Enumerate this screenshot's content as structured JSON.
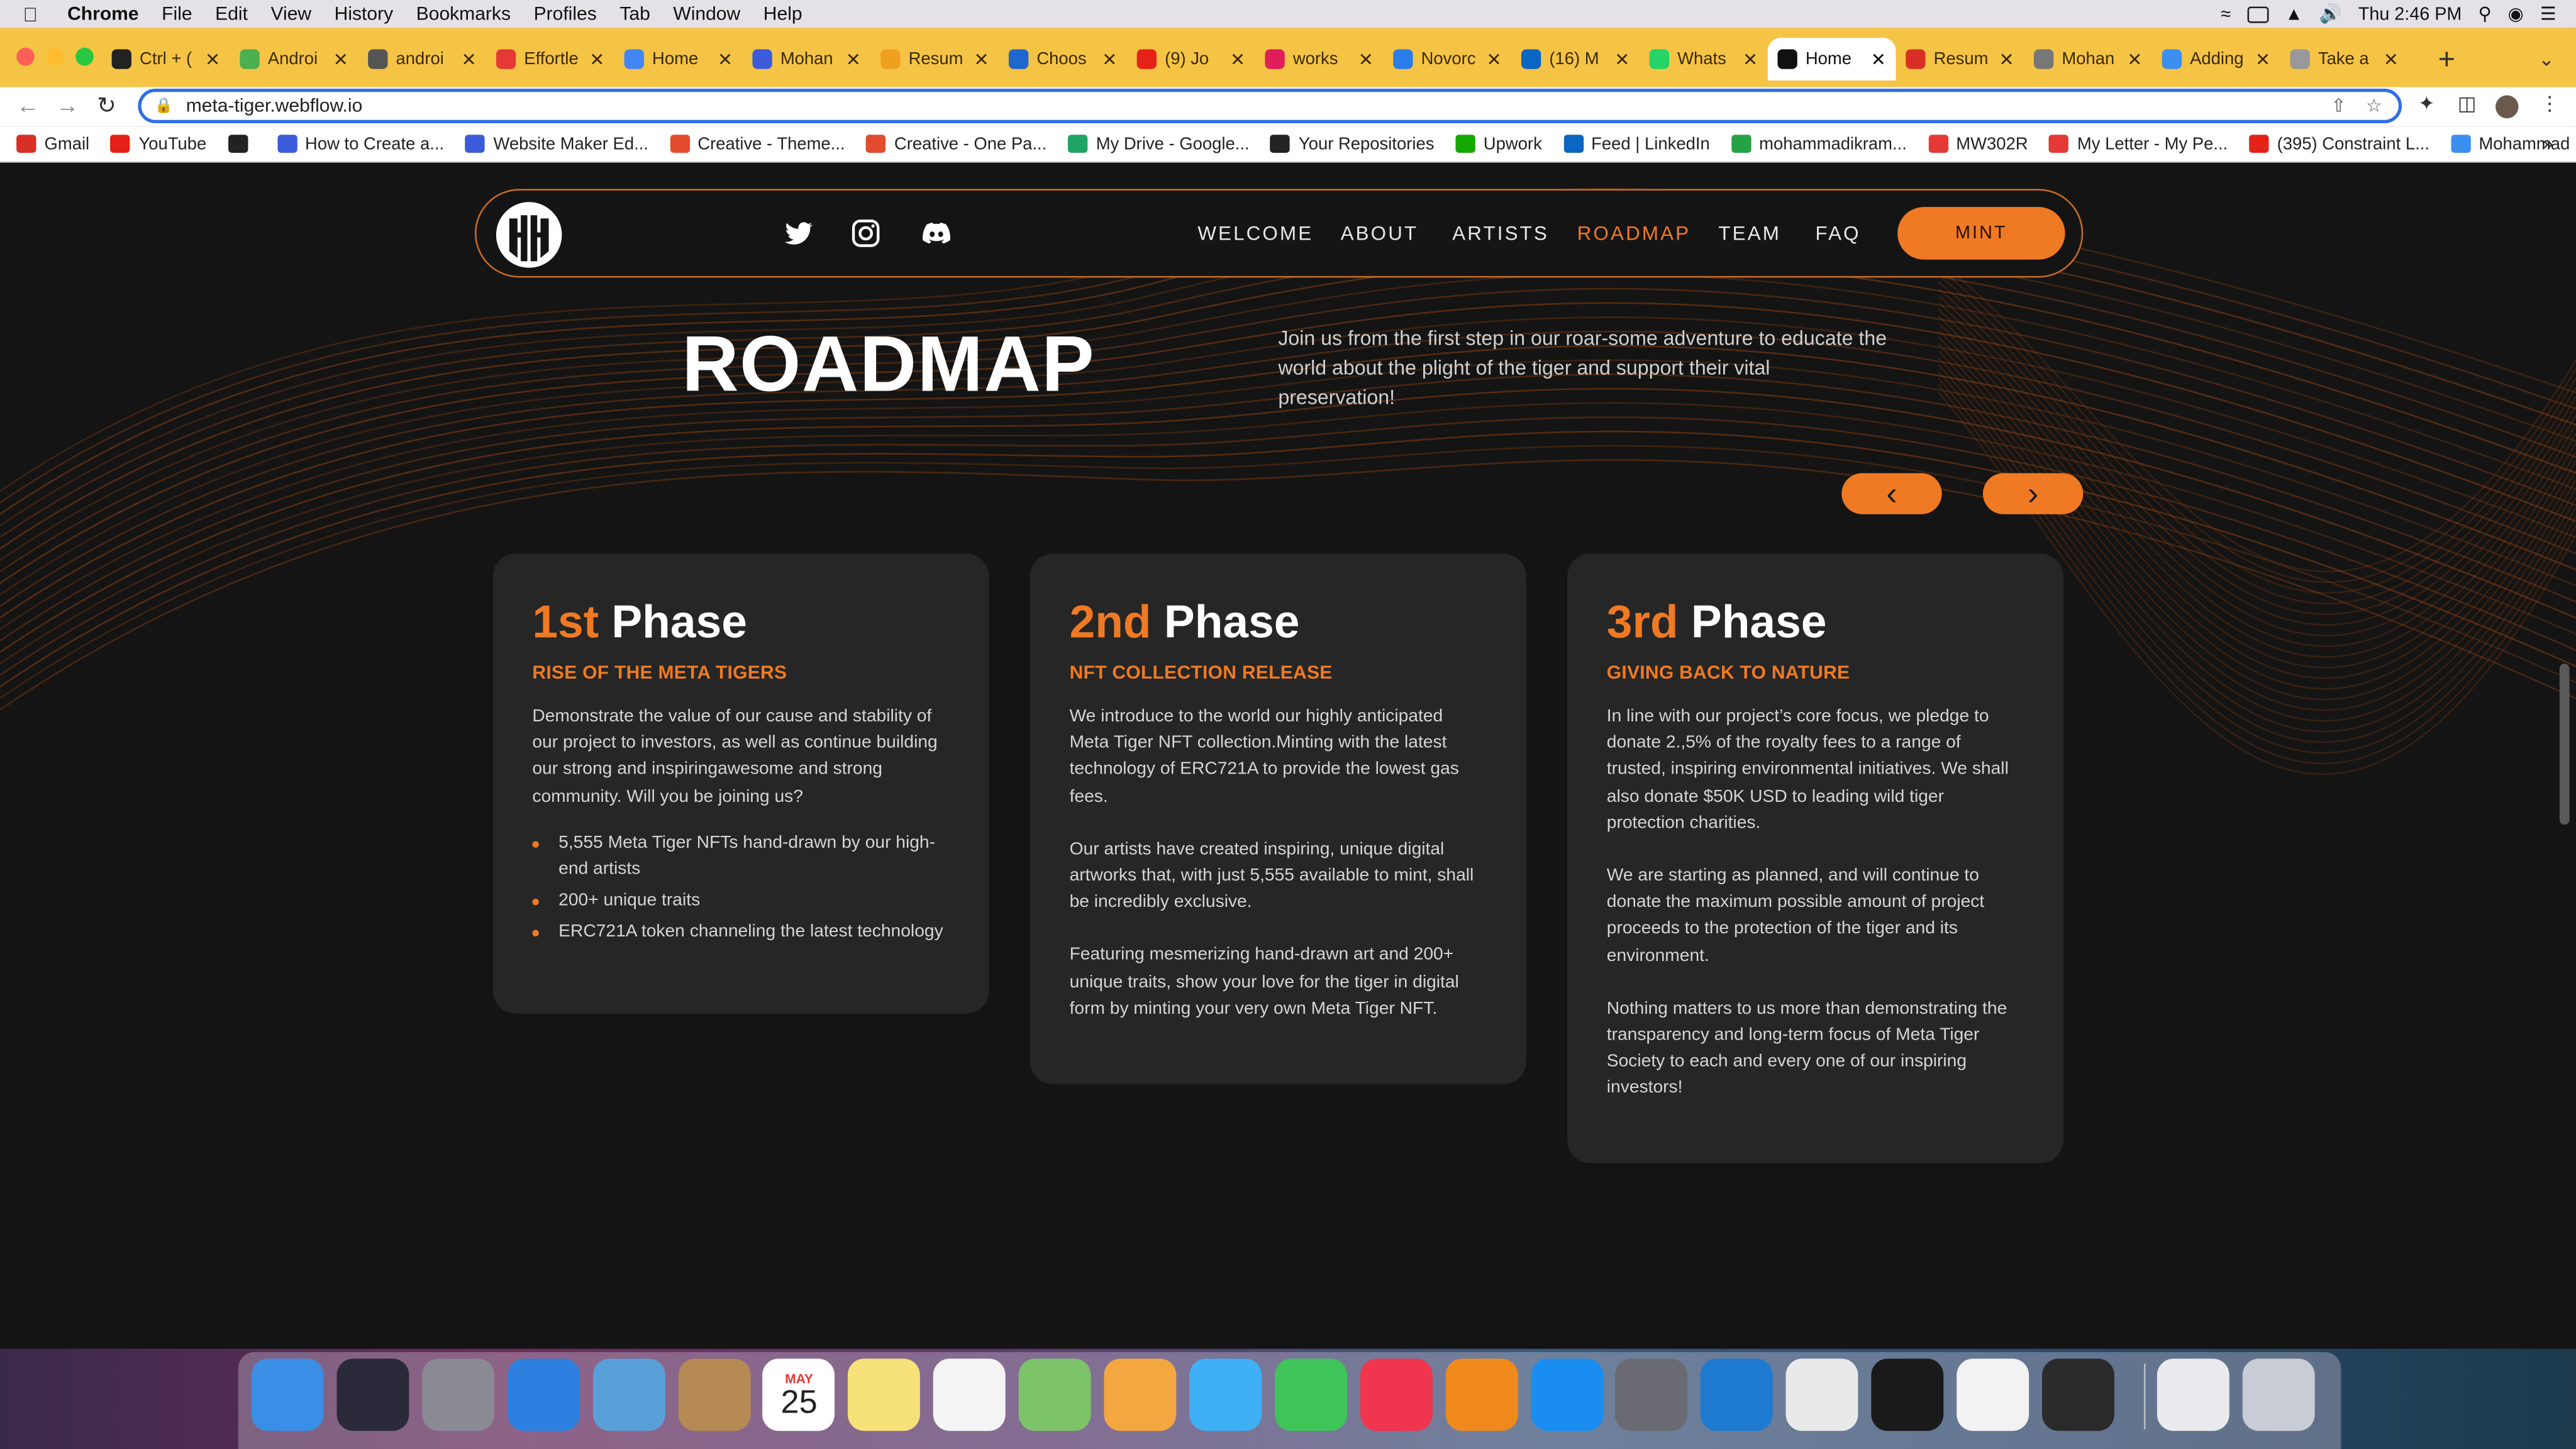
{
  "menubar": {
    "items": [
      "Chrome",
      "File",
      "Edit",
      "View",
      "History",
      "Bookmarks",
      "Profiles",
      "Tab",
      "Window",
      "Help"
    ],
    "clock": "Thu 2:46 PM"
  },
  "tabs": [
    {
      "title": "Ctrl + (",
      "color": "#222222"
    },
    {
      "title": "Androi",
      "color": "#4caf50"
    },
    {
      "title": "androi",
      "color": "#555555"
    },
    {
      "title": "Effortle",
      "color": "#e53935"
    },
    {
      "title": "Home",
      "color": "#4285f4"
    },
    {
      "title": "Mohan",
      "color": "#3b5bdb"
    },
    {
      "title": "Resum",
      "color": "#f0a020"
    },
    {
      "title": "Choos",
      "color": "#1e66d0"
    },
    {
      "title": "(9) Jo",
      "color": "#e62117"
    },
    {
      "title": "works",
      "color": "#e01e5a"
    },
    {
      "title": "Novorc",
      "color": "#2b7de9"
    },
    {
      "title": "(16) M",
      "color": "#0a66c2"
    },
    {
      "title": "Whats",
      "color": "#25d366"
    },
    {
      "title": "Home",
      "color": "#111111",
      "active": true
    },
    {
      "title": "Resum",
      "color": "#d93025"
    },
    {
      "title": "Mohan",
      "color": "#777777"
    },
    {
      "title": "Adding",
      "color": "#3b8ff0"
    },
    {
      "title": "Take a",
      "color": "#999999"
    }
  ],
  "address": {
    "url": "meta-tiger.webflow.io"
  },
  "bookmarks": [
    {
      "label": "Gmail",
      "color": "#d93025"
    },
    {
      "label": "YouTube",
      "color": "#e62117"
    },
    {
      "label": "",
      "color": "#222222"
    },
    {
      "label": "How to Create a...",
      "color": "#3b5bdb"
    },
    {
      "label": "Website Maker Ed...",
      "color": "#3b5bdb"
    },
    {
      "label": "Creative - Theme...",
      "color": "#e34b2e"
    },
    {
      "label": "Creative - One Pa...",
      "color": "#e34b2e"
    },
    {
      "label": "My Drive - Google...",
      "color": "#1fa463"
    },
    {
      "label": "Your Repositories",
      "color": "#222222"
    },
    {
      "label": "Upwork",
      "color": "#14a800"
    },
    {
      "label": "Feed | LinkedIn",
      "color": "#0a66c2"
    },
    {
      "label": "mohammadikram...",
      "color": "#25a244"
    },
    {
      "label": "MW302R",
      "color": "#e53935"
    },
    {
      "label": "My Letter - My Pe...",
      "color": "#e53935"
    },
    {
      "label": "(395) Constraint L...",
      "color": "#e62117"
    },
    {
      "label": "Mohammad I. Prof...",
      "color": "#3b8ff0"
    }
  ],
  "nav": {
    "links": [
      "WELCOME",
      "ABOUT",
      "ARTISTS",
      "ROADMAP",
      "TEAM",
      "FAQ"
    ],
    "active": "ROADMAP",
    "mint": "MINT"
  },
  "roadmap": {
    "title": "ROADMAP",
    "intro": "Join us from the first step in our roar-some adventure to educate the world about the plight of the tiger and support their vital preservation!",
    "prev": "‹",
    "next": "›"
  },
  "phases": [
    {
      "num": "1st",
      "word": " Phase",
      "subtitle": "RISE OF THE META TIGERS",
      "paragraphs": [
        "Demonstrate the value of our cause and stability of our project to investors, as well as continue building our strong and inspiringawesome and strong community. Will you be joining us?"
      ],
      "bullets": [
        "5,555 Meta Tiger NFTs hand-drawn by our high-end artists",
        "200+ unique traits",
        "ERC721A token channeling the latest technology"
      ]
    },
    {
      "num": "2nd",
      "word": " Phase",
      "subtitle": "NFT COLLECTION RELEASE",
      "paragraphs": [
        "We introduce to the world our highly anticipated Meta Tiger NFT collection.Minting with the latest technology of ERC721A to provide the lowest gas fees.",
        "Our artists have created inspiring, unique digital artworks that, with just 5,555 available to mint, shall be incredibly exclusive.",
        "Featuring mesmerizing hand-drawn art and 200+ unique traits, show your love for the tiger in digital form by minting your very own Meta Tiger NFT."
      ],
      "bullets": []
    },
    {
      "num": "3rd",
      "word": " Phase",
      "subtitle": "GIVING BACK TO NATURE",
      "paragraphs": [
        "In line with our project’s core focus, we pledge to donate 2.,5% of the royalty fees to a range of trusted, inspiring environmental initiatives. We shall also donate $50K USD to leading wild tiger protection charities.",
        "We are starting as planned, and will continue to donate the maximum possible amount of project proceeds to the protection of the tiger and its environment.",
        "Nothing matters to us more than demonstrating the transparency and long-term focus of Meta Tiger Society to each and every one of our inspiring investors!"
      ],
      "bullets": []
    }
  ],
  "dock": {
    "apps": [
      {
        "name": "finder-icon",
        "color": "#3a8ee6"
      },
      {
        "name": "siri-icon",
        "color": "#2a2a3a"
      },
      {
        "name": "launchpad-icon",
        "color": "#8a8a95"
      },
      {
        "name": "safari-icon",
        "color": "#2d7fe0"
      },
      {
        "name": "mail-icon",
        "color": "#5aa0d8"
      },
      {
        "name": "contacts-icon",
        "color": "#b58a55"
      },
      {
        "name": "calendar-icon",
        "color": "#ffffff"
      },
      {
        "name": "notes-icon",
        "color": "#f7e27a"
      },
      {
        "name": "reminders-icon",
        "color": "#f4f4f4"
      },
      {
        "name": "maps-icon",
        "color": "#7cc36a"
      },
      {
        "name": "photos-icon",
        "color": "#f4a640"
      },
      {
        "name": "messages-icon",
        "color": "#3fb0f5"
      },
      {
        "name": "facetime-icon",
        "color": "#3fc45a"
      },
      {
        "name": "music-icon",
        "color": "#f0364f"
      },
      {
        "name": "books-icon",
        "color": "#f08a1c"
      },
      {
        "name": "app-store-icon",
        "color": "#1a8df0"
      },
      {
        "name": "system-preferences-icon",
        "color": "#6a6a72"
      },
      {
        "name": "vscode-icon",
        "color": "#1e7ad0"
      },
      {
        "name": "chrome-icon",
        "color": "#e9e9e9"
      },
      {
        "name": "terminal-icon",
        "color": "#1a1a1a"
      },
      {
        "name": "textedit-icon",
        "color": "#f2f2f2"
      },
      {
        "name": "piano-icon",
        "color": "#2a2a2a"
      },
      {
        "name": "document-icon",
        "color": "#e9e9ee"
      },
      {
        "name": "trash-icon",
        "color": "#c8ccd4"
      }
    ],
    "calendar_month": "MAY",
    "calendar_day": "25"
  }
}
